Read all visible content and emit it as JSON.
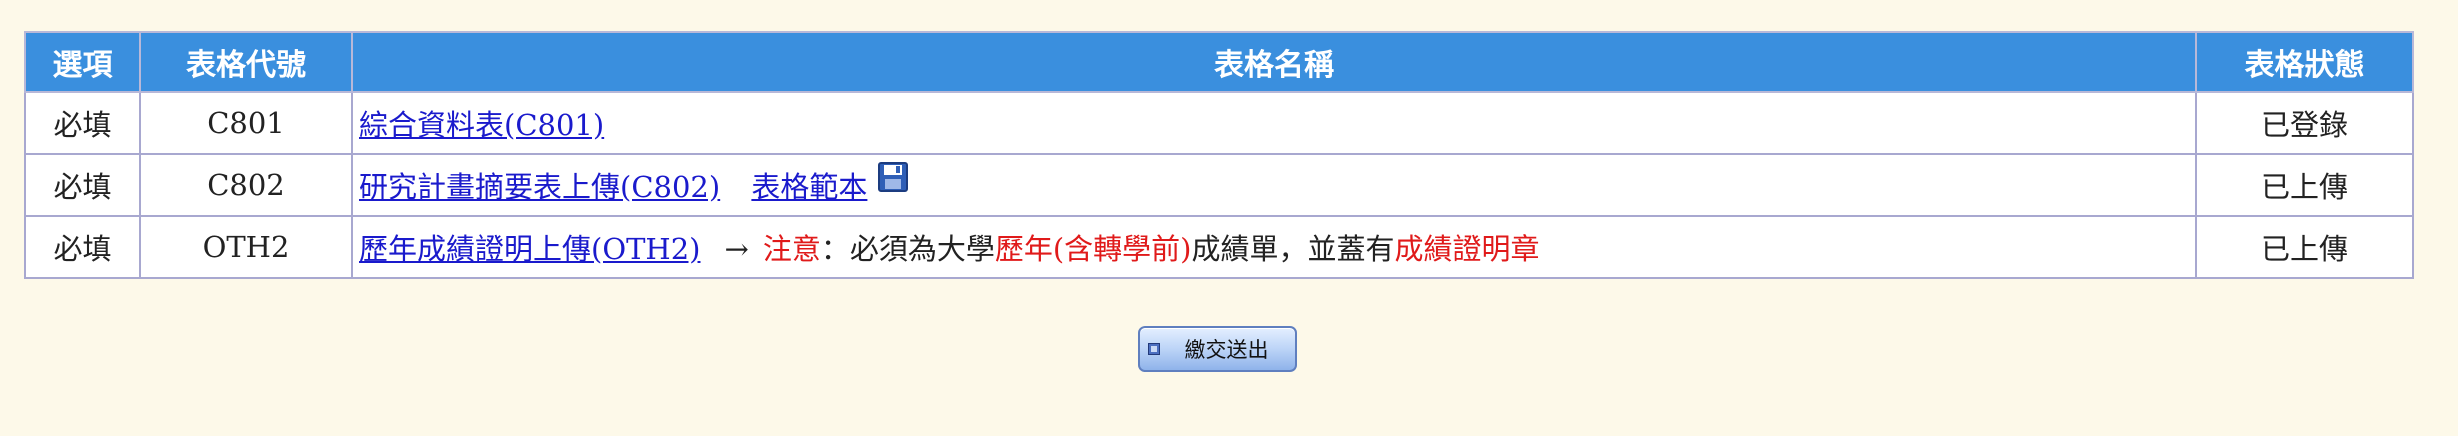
{
  "table": {
    "headers": {
      "option": "選項",
      "code": "表格代號",
      "name": "表格名稱",
      "status": "表格狀態"
    },
    "rows": [
      {
        "option": "必填",
        "code": "C801",
        "name_link": "綜合資料表(C801)",
        "status": "已登錄"
      },
      {
        "option": "必填",
        "code": "C802",
        "name_link": "研究計畫摘要表上傳(C802)",
        "sample_link": "表格範本",
        "sample_icon": "floppy-disk-icon",
        "status": "已上傳"
      },
      {
        "option": "必填",
        "code": "OTH2",
        "name_link": "歷年成績證明上傳(OTH2)",
        "arrow": "→",
        "note_label": "注意",
        "note_text_1": "：必須為大學",
        "note_highlight_1": "歷年(含轉學前)",
        "note_text_2": "成績單，並蓋有",
        "note_highlight_2": "成績證明章",
        "status": "已上傳"
      }
    ]
  },
  "submit": {
    "label": "繳交送出",
    "icon": "square-bullet-icon"
  },
  "colors": {
    "background": "#fdf9e9",
    "header": "#3a8fde",
    "link": "#1a1acc",
    "highlight": "#e01a1a"
  }
}
